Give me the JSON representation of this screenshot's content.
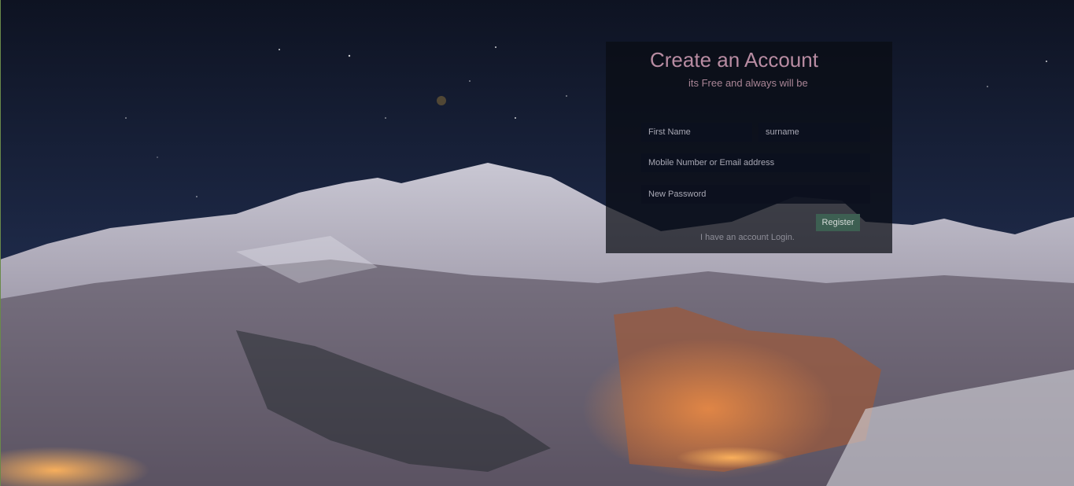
{
  "form": {
    "title": "Create an Account",
    "subtitle": "its Free and always will be",
    "first_name_placeholder": "First Name",
    "surname_placeholder": "surname",
    "contact_placeholder": "Mobile Number or Email address",
    "password_placeholder": "New Password",
    "register_label": "Register",
    "login_link": "I have an account Login."
  },
  "colors": {
    "accent_title": "#b88ca2",
    "register_button": "#3d5f52"
  }
}
